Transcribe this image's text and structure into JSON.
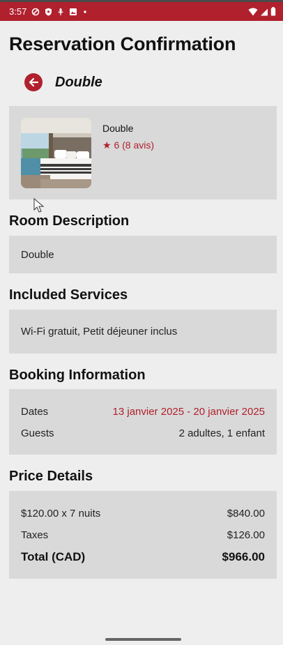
{
  "status_bar": {
    "time": "3:57"
  },
  "page_title": "Reservation Confirmation",
  "header": {
    "room_name": "Double"
  },
  "room_card": {
    "name": "Double",
    "rating": "★ 6 (8 avis)"
  },
  "sections": {
    "description": {
      "heading": "Room Description",
      "text": "Double"
    },
    "services": {
      "heading": "Included Services",
      "text": "Wi-Fi gratuit, Petit déjeuner inclus"
    },
    "booking": {
      "heading": "Booking Information",
      "dates_label": "Dates",
      "dates_value": "13 janvier 2025 - 20 janvier 2025",
      "guests_label": "Guests",
      "guests_value": "2 adultes, 1 enfant"
    },
    "price": {
      "heading": "Price Details",
      "nights_label": "$120.00 x 7 nuits",
      "nights_value": "$840.00",
      "taxes_label": "Taxes",
      "taxes_value": "$126.00",
      "total_label": "Total (CAD)",
      "total_value": "$966.00"
    }
  },
  "colors": {
    "accent": "#b0202d",
    "card_bg": "#d9d9d9",
    "page_bg": "#eeeeee"
  },
  "icons": [
    "vpn-key-icon",
    "shield-icon",
    "mic-icon",
    "photo-icon",
    "dot-icon",
    "wifi-icon",
    "signal-icon",
    "battery-icon",
    "back-arrow-icon",
    "star-icon",
    "cursor-icon"
  ]
}
